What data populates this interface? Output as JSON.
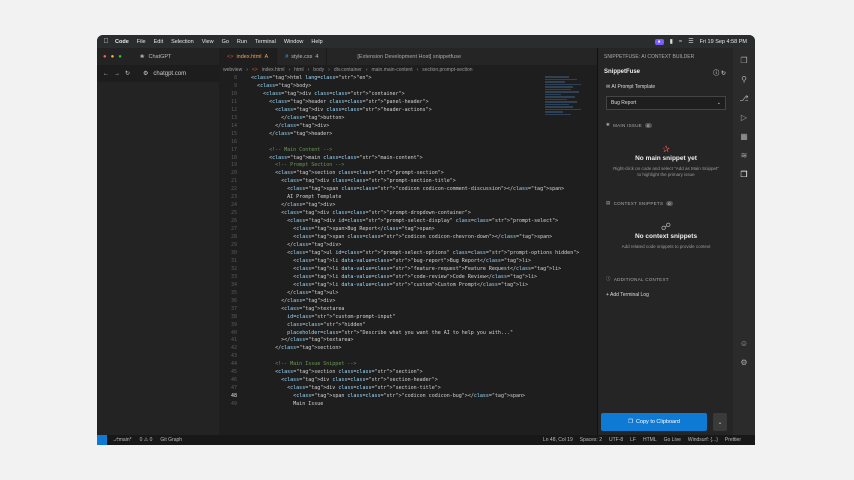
{
  "menubar": {
    "items": [
      "Code",
      "File",
      "Edit",
      "Selection",
      "View",
      "Go",
      "Run",
      "Terminal",
      "Window",
      "Help"
    ],
    "clock": "Fri 19 Sep  4:58 PM"
  },
  "browser": {
    "tab_label": "ChatGPT",
    "url": "chatgpt.com"
  },
  "editor": {
    "tabs": [
      {
        "label": "index.html",
        "modified": "A"
      },
      {
        "label": "style.css",
        "modified": "4"
      }
    ],
    "window_title": "[Extension Development Host] snippetfuse",
    "breadcrumb": [
      "webview",
      "index.html",
      "html",
      "body",
      "div.container",
      "main.main-content",
      "section.prompt-section"
    ],
    "lines": [
      {
        "n": "8",
        "t": "  <html lang=\"en\">"
      },
      {
        "n": "9",
        "t": "    <body>"
      },
      {
        "n": "10",
        "t": "      <div class=\"container\">"
      },
      {
        "n": "11",
        "t": "        <header class=\"panel-header\">"
      },
      {
        "n": "12",
        "t": "          <div class=\"header-actions\">"
      },
      {
        "n": "13",
        "t": "            </button>"
      },
      {
        "n": "14",
        "t": "          </div>"
      },
      {
        "n": "15",
        "t": "        </header>"
      },
      {
        "n": "16",
        "t": ""
      },
      {
        "n": "17",
        "t": "        <!-- Main Content -->"
      },
      {
        "n": "18",
        "t": "        <main class=\"main-content\">"
      },
      {
        "n": "19",
        "t": "          <!-- Prompt Section -->"
      },
      {
        "n": "20",
        "t": "          <section class=\"prompt-section\">"
      },
      {
        "n": "21",
        "t": "            <div class=\"prompt-section-title\">"
      },
      {
        "n": "22",
        "t": "              <span class=\"codicon codicon-comment-discussion\"></span>"
      },
      {
        "n": "23",
        "t": "              AI Prompt Template"
      },
      {
        "n": "24",
        "t": "            </div>"
      },
      {
        "n": "25",
        "t": "            <div class=\"prompt-dropdown-container\">"
      },
      {
        "n": "26",
        "t": "              <div id=\"prompt-select-display\" class=\"prompt-select\">"
      },
      {
        "n": "27",
        "t": "                <span>Bug Report</span>"
      },
      {
        "n": "28",
        "t": "                <span class=\"codicon codicon-chevron-down\"></span>"
      },
      {
        "n": "29",
        "t": "              </div>"
      },
      {
        "n": "30",
        "t": "              <ul id=\"prompt-select-options\" class=\"prompt-options hidden\">"
      },
      {
        "n": "31",
        "t": "                <li data-value=\"bug-report\">Bug Report</li>"
      },
      {
        "n": "32",
        "t": "                <li data-value=\"feature-request\">Feature Request</li>"
      },
      {
        "n": "33",
        "t": "                <li data-value=\"code-review\">Code Review</li>"
      },
      {
        "n": "34",
        "t": "                <li data-value=\"custom\">Custom Prompt</li>"
      },
      {
        "n": "35",
        "t": "              </ul>"
      },
      {
        "n": "36",
        "t": "            </div>"
      },
      {
        "n": "37",
        "t": "            <textarea"
      },
      {
        "n": "38",
        "t": "              id=\"custom-prompt-input\""
      },
      {
        "n": "39",
        "t": "              class=\"hidden\""
      },
      {
        "n": "40",
        "t": "              placeholder=\"Describe what you want the AI to help you with...\""
      },
      {
        "n": "41",
        "t": "            ></textarea>"
      },
      {
        "n": "42",
        "t": "          </section>"
      },
      {
        "n": "43",
        "t": ""
      },
      {
        "n": "44",
        "t": "          <!-- Main Issue Snippet -->"
      },
      {
        "n": "45",
        "t": "          <section class=\"section\">"
      },
      {
        "n": "46",
        "t": "            <div class=\"section-header\">"
      },
      {
        "n": "47",
        "t": "              <div class=\"section-title\">"
      },
      {
        "n": "48",
        "t": "                <span class=\"codicon codicon-bug\"></span>"
      },
      {
        "n": "49",
        "t": "                Main Issue"
      }
    ]
  },
  "panel": {
    "title": "SNIPPETFUSE: AI CONTEXT BUILDER",
    "heading": "SnippetFuse",
    "template_label": "AI Prompt Template",
    "template_value": "Bug Report",
    "main_issue": {
      "label": "MAIN ISSUE",
      "count": "0",
      "empty_title": "No main snippet yet",
      "empty_desc": "Right-click on code and select \"Add as Main Snippet\" to highlight the primary issue"
    },
    "context": {
      "label": "CONTEXT SNIPPETS",
      "count": "0",
      "empty_title": "No context snippets",
      "empty_desc": "Add related code snippets to provide context"
    },
    "additional": "ADDITIONAL CONTEXT",
    "add_terminal": "Add Terminal Log",
    "copy": "Copy to Clipboard"
  },
  "statusbar": {
    "branch": "main*",
    "problems": "0 ⚠ 0",
    "git_graph": "Git Graph",
    "position": "Ln 48, Col 19",
    "spaces": "Spaces: 2",
    "encoding": "UTF-8",
    "eol": "LF",
    "lang": "HTML",
    "golive": "Go Live",
    "windsurf": "Windsurf: {...}",
    "prettier": "Prettier"
  },
  "colors": {
    "accent": "#0e7ad4",
    "active_tab": "#f0a35e",
    "bg": "#1e1e1e"
  }
}
